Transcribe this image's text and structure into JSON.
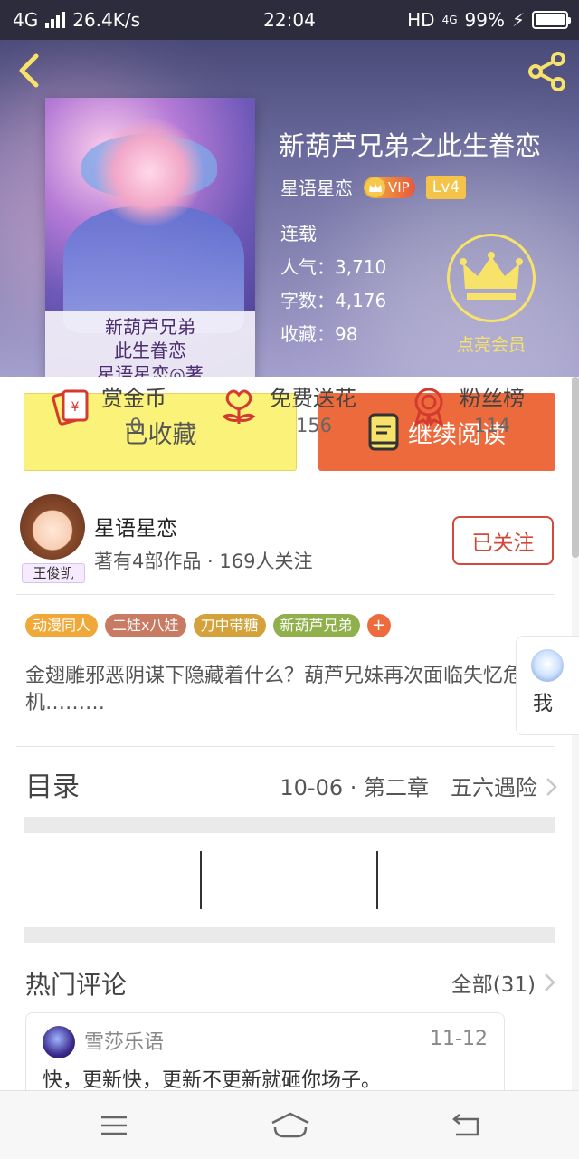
{
  "status_bar": {
    "network": "4G",
    "speed": "26.4K/s",
    "time": "22:04",
    "hd": "HD",
    "net_small": "4G",
    "battery": "99%",
    "battery_level": 0.99
  },
  "header": {
    "back_icon": "chevron-left-icon",
    "share_icon": "share-icon",
    "cover": {
      "line1": "新葫芦兄弟",
      "line2": "此生眷恋",
      "line3": "星语星恋◎著"
    },
    "title": "新葫芦兄弟之此生眷恋",
    "author": "星语星恋",
    "vip_label": "VIP",
    "level": "Lv4",
    "status": "连载",
    "popularity": "人气：3,710",
    "words": "字数：4,176",
    "favorites": "收藏：98",
    "vip_cta": "点亮会员"
  },
  "actions": {
    "collected": "已收藏",
    "continue": "继续阅读"
  },
  "author_box": {
    "avatar_tag": "王俊凯",
    "name": "星语星恋",
    "stats": "著有4部作品 · 169人关注",
    "follow": "已关注"
  },
  "tags": [
    {
      "label": "动漫同人",
      "color": "#f0a938"
    },
    {
      "label": "二娃x八娃",
      "color": "#c97a63"
    },
    {
      "label": "刀中带糖",
      "color": "#d4a13a"
    },
    {
      "label": "新葫芦兄弟",
      "color": "#8fb04a"
    }
  ],
  "tag_add": "+",
  "description": "金翅雕邪恶阴谋下隐藏着什么？葫芦兄妹再次面临失忆危机………",
  "toc": {
    "label": "目录",
    "latest": "10-06 · 第二章　五六遇险"
  },
  "stats": [
    {
      "name": "赏金币",
      "value": "0",
      "icon": "red-envelope-icon"
    },
    {
      "name": "免费送花",
      "value": "156",
      "icon": "flower-icon"
    },
    {
      "name": "粉丝榜",
      "value": "114",
      "icon": "medal-icon"
    }
  ],
  "comments": {
    "title": "热门评论",
    "all": "全部(31)",
    "items": [
      {
        "user": "雪莎乐语",
        "date": "11-12",
        "text": "快，更新快，更新不更新就砸你场子。"
      },
      {
        "user": "",
        "date": "",
        "text": "我"
      }
    ]
  },
  "nav": {
    "menu_icon": "menu-icon",
    "home_icon": "home-icon",
    "back_icon": "back-icon"
  }
}
